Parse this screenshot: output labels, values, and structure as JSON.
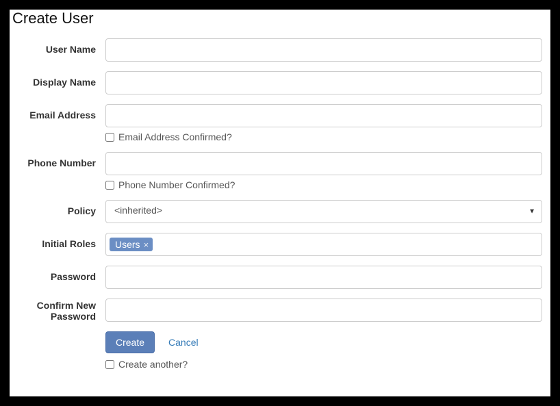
{
  "title": "Create User",
  "fields": {
    "username": {
      "label": "User Name",
      "value": ""
    },
    "displayname": {
      "label": "Display Name",
      "value": ""
    },
    "email": {
      "label": "Email Address",
      "value": "",
      "confirmed_label": "Email Address Confirmed?",
      "confirmed": false
    },
    "phone": {
      "label": "Phone Number",
      "value": "",
      "confirmed_label": "Phone Number Confirmed?",
      "confirmed": false
    },
    "policy": {
      "label": "Policy",
      "value": "<inherited>"
    },
    "roles": {
      "label": "Initial Roles",
      "tags": [
        "Users"
      ]
    },
    "password": {
      "label": "Password",
      "value": ""
    },
    "confirm_password": {
      "label": "Confirm New Password",
      "value": ""
    }
  },
  "actions": {
    "create": "Create",
    "cancel": "Cancel",
    "create_another": {
      "label": "Create another?",
      "checked": false
    }
  }
}
